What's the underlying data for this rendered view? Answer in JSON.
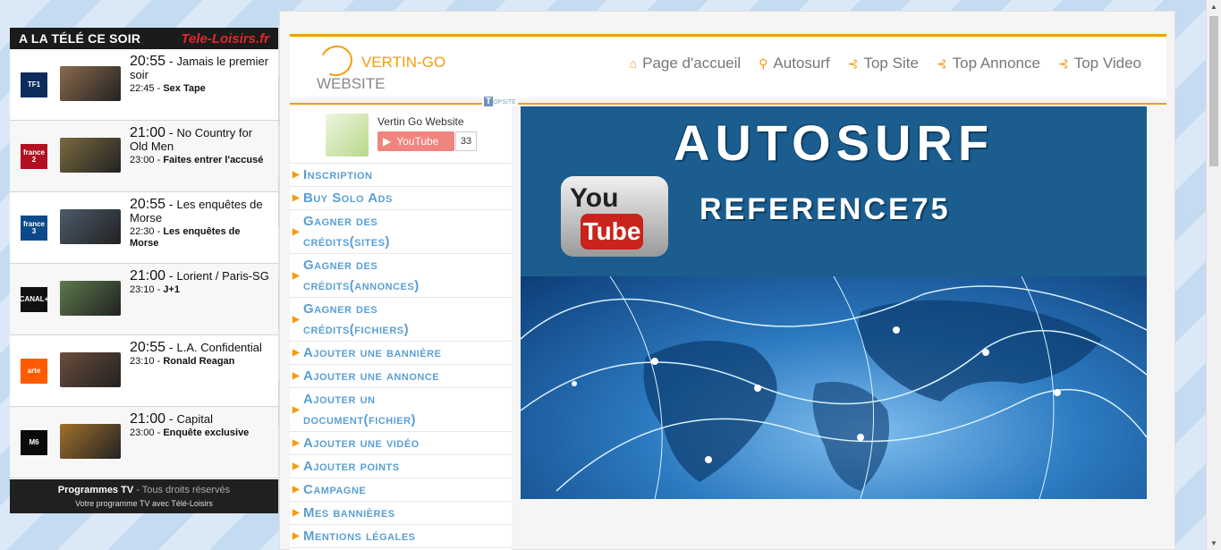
{
  "tv_widget": {
    "title": "A LA TÉLÉ CE SOIR",
    "brand": "Tele-Loisirs.fr",
    "rows": [
      {
        "channel": "TF1",
        "time1": "20:55",
        "title1": "Jamais le premier soir",
        "time2": "22:45",
        "title2": "Sex Tape"
      },
      {
        "channel": "france 2",
        "time1": "21:00",
        "title1": "No Country for Old Men",
        "time2": "23:00",
        "title2": "Faites entrer l'accusé"
      },
      {
        "channel": "france 3",
        "time1": "20:55",
        "title1": "Les enquêtes de Morse",
        "time2": "22:30",
        "title2": "Les enquêtes de Morse"
      },
      {
        "channel": "CANAL+",
        "time1": "21:00",
        "title1": "Lorient / Paris-SG",
        "time2": "23:10",
        "title2": "J+1"
      },
      {
        "channel": "arte",
        "time1": "20:55",
        "title1": "L.A. Confidential",
        "time2": "23:10",
        "title2": "Ronald Reagan"
      },
      {
        "channel": "M6",
        "time1": "21:00",
        "title1": "Capital",
        "time2": "23:00",
        "title2": "Enquête exclusive"
      }
    ],
    "footer_bold": "Programmes TV",
    "footer_rest": " - Tous droits réservés",
    "footer_line2": "Votre programme TV avec Télé-Loisirs"
  },
  "header": {
    "logo_line1": "VERTIN-GO",
    "logo_line2": "WEBSITE",
    "nav": [
      {
        "icon": "home-icon",
        "label": "Page d'accueil"
      },
      {
        "icon": "search-icon",
        "label": "Autosurf"
      },
      {
        "icon": "arrow-left-icon",
        "label": "Top Site"
      },
      {
        "icon": "arrow-left-icon",
        "label": "Top Annonce"
      },
      {
        "icon": "arrow-left-icon",
        "label": "Top Video"
      }
    ],
    "topsite_badge": "TOPSITE"
  },
  "youtube_widget": {
    "channel_name": "Vertin Go Website",
    "button_label": "YouTube",
    "subscriber_count": "33"
  },
  "menu": [
    {
      "label": "Inscription",
      "lines": 1
    },
    {
      "label": "Buy Solo Ads",
      "lines": 1
    },
    {
      "label": "Gagner des crédits(sites)",
      "lines": 2
    },
    {
      "label": "Gagner des crédits(annonces)",
      "lines": 2
    },
    {
      "label": "Gagner des crédits(fichiers)",
      "lines": 2
    },
    {
      "label": "Ajouter une bannière",
      "lines": 1
    },
    {
      "label": "Ajouter une annonce",
      "lines": 1
    },
    {
      "label": "Ajouter un document(fichier)",
      "lines": 2
    },
    {
      "label": "Ajouter une vidéo",
      "lines": 1
    },
    {
      "label": "Ajouter points",
      "lines": 1
    },
    {
      "label": "Campagne",
      "lines": 1
    },
    {
      "label": "Mes bannières",
      "lines": 1
    },
    {
      "label": "Mentions légales",
      "lines": 1
    }
  ],
  "banner": {
    "headline": "AUTOSURF",
    "subline": "REFERENCE75",
    "yt_you": "You",
    "yt_tube": "Tube"
  },
  "colors": {
    "accent": "#f39c12",
    "menu_link": "#5a9fd4",
    "tv_header": "#1b1b1b",
    "youtube_red": "#e62117"
  }
}
